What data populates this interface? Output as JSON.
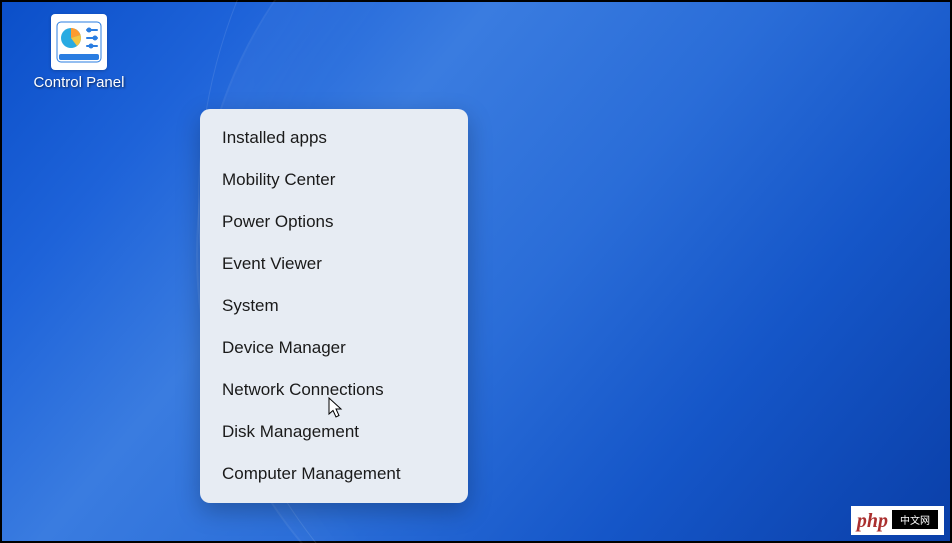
{
  "desktop": {
    "icon": {
      "label": "Control Panel",
      "name": "control-panel"
    }
  },
  "context_menu": {
    "items": [
      "Installed apps",
      "Mobility Center",
      "Power Options",
      "Event Viewer",
      "System",
      "Device Manager",
      "Network Connections",
      "Disk Management",
      "Computer Management"
    ]
  },
  "watermark": {
    "left": "php",
    "right": "中文网"
  }
}
